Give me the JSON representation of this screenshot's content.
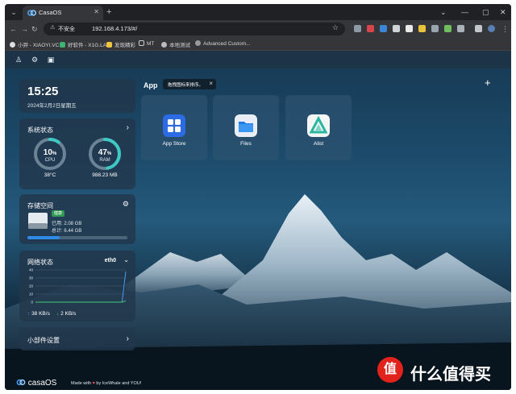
{
  "browser": {
    "tab_title": "CasaOS",
    "new_tab": "+",
    "window_controls": [
      "⌄",
      "—",
      "▢",
      "✕"
    ],
    "omnibox": {
      "insecure_label": "不安全",
      "url": "192.168.4.173/#/"
    },
    "bookmarks": [
      "小羿 - XIAOYI.VC",
      "好软件 - X1G.LA",
      "发现精彩",
      "MT",
      "本地测试",
      "Advanced Custom..."
    ]
  },
  "casaos": {
    "clock": {
      "time": "15:25",
      "date": "2024年2月2日星期五"
    },
    "system_status": {
      "title": "系统状态",
      "cpu": {
        "percent": 10,
        "label": "CPU",
        "temp": "38°C"
      },
      "ram": {
        "percent": 47,
        "label": "RAM",
        "used": "988.23 MB"
      }
    },
    "storage": {
      "title": "存储空间",
      "badge": "健康",
      "used": "已用: 2.08 GB",
      "total": "总计: 6.44 GB",
      "fill_fraction": 0.32
    },
    "network": {
      "title": "网络状态",
      "interface": "eth0",
      "up": "38 KB/s",
      "down": "2 KB/s"
    },
    "widgets": {
      "title": "小部件设置"
    },
    "apps": {
      "label": "App",
      "tooltip": "拖拽图标来排序。",
      "items": [
        {
          "label": "App Store",
          "color": "#2d6be4"
        },
        {
          "label": "Files",
          "color": "#e9eef5"
        },
        {
          "label": "Alist",
          "color": "#f3f6f5"
        }
      ]
    },
    "footer": {
      "brand": "casaOS",
      "made_pre": "Made with",
      "made_post": "by IceWhale and YOU!"
    }
  },
  "chart_data": {
    "type": "line",
    "y_ticks": [
      "40",
      "30",
      "20",
      "10",
      "0"
    ],
    "ylim": [
      0,
      40
    ],
    "series": [
      {
        "values": [
          0,
          0,
          0,
          0,
          0,
          0,
          0,
          0,
          0,
          0,
          0,
          0,
          0,
          0,
          0,
          0,
          0,
          0,
          0,
          0,
          0,
          0,
          0,
          0,
          38
        ],
        "color": "#4aa8ff"
      },
      {
        "values": [
          0,
          0,
          0,
          0,
          0,
          0,
          0,
          0,
          0,
          0,
          0,
          0,
          0,
          0,
          0,
          0,
          0,
          0,
          0,
          0,
          0,
          0,
          0,
          0,
          2
        ],
        "color": "#3ccf7a"
      }
    ]
  },
  "watermark": {
    "badge": "值",
    "text": "什么值得买"
  }
}
